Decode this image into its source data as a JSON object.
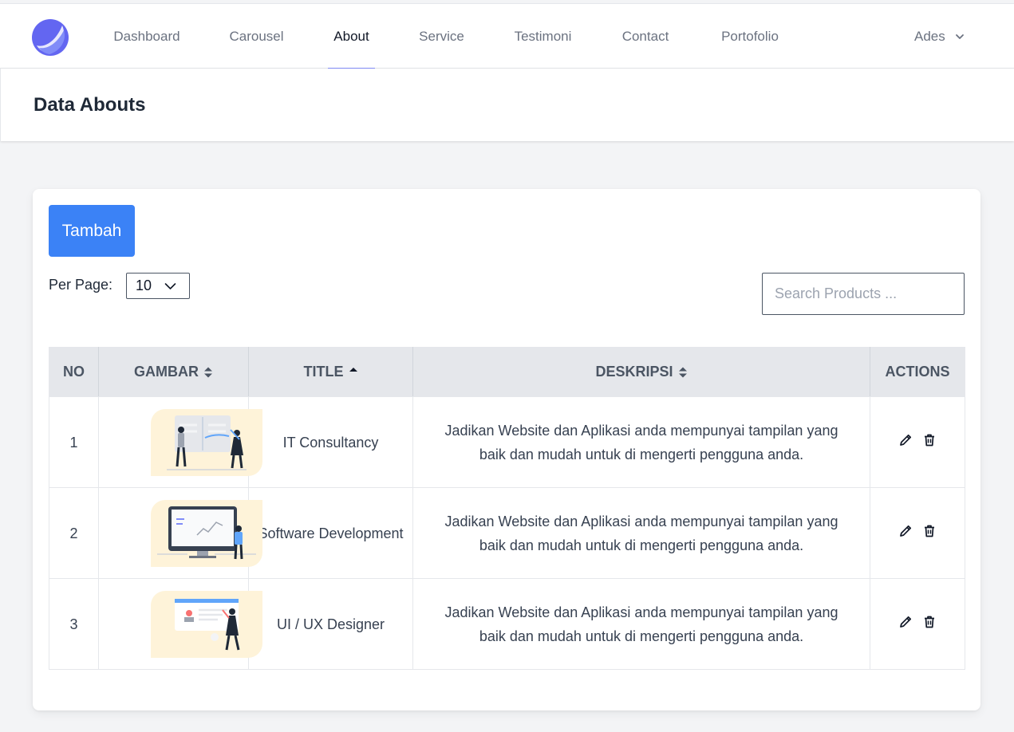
{
  "nav": {
    "items": [
      {
        "label": "Dashboard",
        "active": false
      },
      {
        "label": "Carousel",
        "active": false
      },
      {
        "label": "About",
        "active": true
      },
      {
        "label": "Service",
        "active": false
      },
      {
        "label": "Testimoni",
        "active": false
      },
      {
        "label": "Contact",
        "active": false
      },
      {
        "label": "Portofolio",
        "active": false
      }
    ],
    "user": "Ades",
    "accent": "#818cf8"
  },
  "header": {
    "title": "Data Abouts"
  },
  "toolbar": {
    "add_label": "Tambah",
    "per_page_label": "Per Page:",
    "per_page_value": "10",
    "search_placeholder": "Search Products ..."
  },
  "table": {
    "columns": [
      "NO",
      "GAMBAR",
      "TITLE",
      "DESKRIPSI",
      "ACTIONS"
    ],
    "rows": [
      {
        "no": "1",
        "title": "IT Consultancy",
        "desc": "Jadikan Website dan Aplikasi anda mempunyai tampilan yang baik dan mudah untuk di mengerti pengguna anda."
      },
      {
        "no": "2",
        "title": "Software Development",
        "desc": "Jadikan Website dan Aplikasi anda mempunyai tampilan yang baik dan mudah untuk di mengerti pengguna anda."
      },
      {
        "no": "3",
        "title": "UI / UX Designer",
        "desc": "Jadikan Website dan Aplikasi anda mempunyai tampilan yang baik dan mudah untuk di mengerti pengguna anda."
      }
    ]
  },
  "colors": {
    "primary_button": "#3b82f6",
    "thumb_bg": "#fef3d9"
  }
}
